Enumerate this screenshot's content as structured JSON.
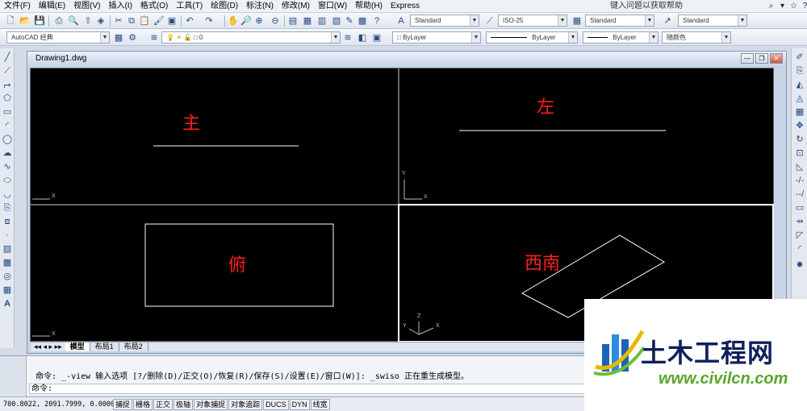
{
  "menu": {
    "items": [
      "文件(F)",
      "编辑(E)",
      "视图(V)",
      "插入(I)",
      "格式(O)",
      "工具(T)",
      "绘图(D)",
      "标注(N)",
      "修改(M)",
      "窗口(W)",
      "帮助(H)",
      "Express"
    ],
    "help_search_placeholder": "键入问题以获取帮助"
  },
  "styles_toolbar": {
    "text_style": "Standard",
    "dim_style": "ISO-25",
    "table_style": "Standard",
    "multileader_style": "Standard"
  },
  "workspace": "AutoCAD 经典",
  "layer": {
    "current": "0"
  },
  "properties": {
    "color": "ByLayer",
    "linetype": "ByLayer",
    "lineweight": "ByLayer",
    "plotstyle": "随颜色"
  },
  "drawing": {
    "title": "Drawing1.dwg",
    "viewports": {
      "front_label": "主",
      "left_label": "左",
      "top_label": "俯",
      "sw_label": "西南"
    },
    "axes": {
      "x": "X",
      "y": "Y",
      "z": "Z"
    },
    "layout_tabs": [
      "模型",
      "布局1",
      "布局2"
    ],
    "active_tab": "模型"
  },
  "command": {
    "history": "命令: _-view 输入选项 [?/删除(D)/正交(O)/恢复(R)/保存(S)/设置(E)/窗口(W)]: _swiso 正在重生成模型。",
    "prompt": "命令:"
  },
  "status": {
    "coordinates": "700.8022,  2091.7999, 0.0000",
    "toggles": [
      "捕捉",
      "栅格",
      "正交",
      "极轴",
      "对象捕捉",
      "对象追踪",
      "DUCS",
      "DYN",
      "线宽"
    ]
  },
  "watermark": {
    "title": "土木工程网",
    "url": "www.civilcn.com"
  },
  "colors": {
    "viewport_bg": "#000000",
    "label_red": "#ff1e1e",
    "geometry": "#ffffff"
  }
}
